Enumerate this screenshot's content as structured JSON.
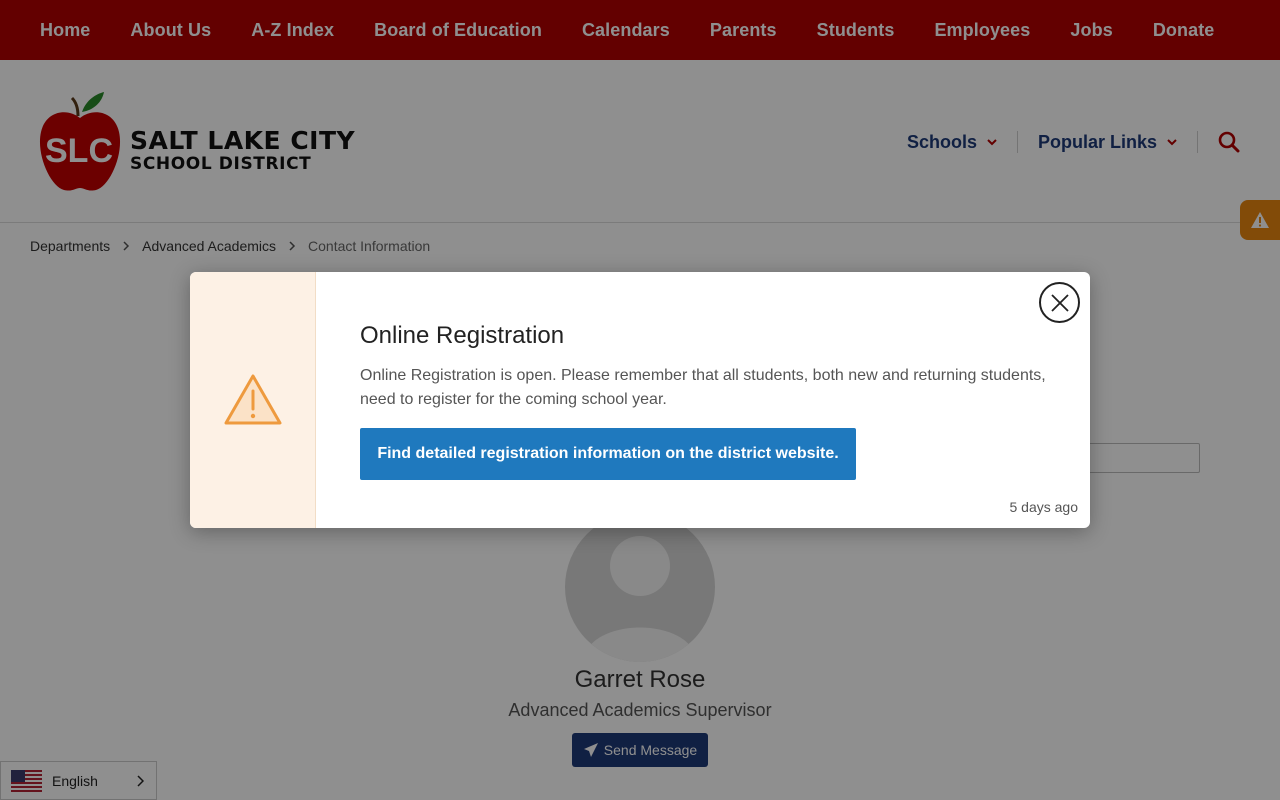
{
  "topnav": {
    "items": [
      "Home",
      "About Us",
      "A-Z Index",
      "Board of Education",
      "Calendars",
      "Parents",
      "Students",
      "Employees",
      "Jobs",
      "Donate"
    ]
  },
  "header": {
    "logo_initials": "SLC",
    "logo_line1": "SALT LAKE CITY",
    "logo_line2": "SCHOOL DISTRICT",
    "links": [
      "Schools",
      "Popular Links"
    ],
    "search_icon": "search-icon"
  },
  "breadcrumb": {
    "items": [
      "Departments",
      "Advanced Academics",
      "Contact Information"
    ]
  },
  "contact": {
    "name": "Garret Rose",
    "title": "Advanced Academics Supervisor",
    "send_label": "Send Message"
  },
  "language": {
    "selected": "English"
  },
  "modal": {
    "title": "Online Registration",
    "text": "Online Registration is open. Please remember that all students, both new and returning students, need to register for the coming school year.",
    "link_label": "Find detailed registration information on the district website.",
    "time": "5 days ago"
  },
  "colors": {
    "brand_red": "#b10000",
    "brand_blue": "#1e3a78",
    "alert_orange": "#e8870f",
    "button_blue": "#1f79be"
  }
}
